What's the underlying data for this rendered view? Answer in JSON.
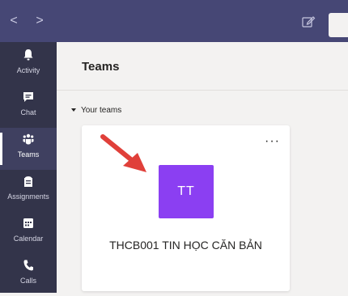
{
  "topbar": {
    "back_icon": "chevron-left-icon",
    "forward_icon": "chevron-right-icon",
    "compose_icon": "compose-icon",
    "back_glyph": "<",
    "forward_glyph": ">"
  },
  "rail": {
    "items": [
      {
        "label": "Activity",
        "icon": "bell-icon"
      },
      {
        "label": "Chat",
        "icon": "chat-icon"
      },
      {
        "label": "Teams",
        "icon": "teams-icon",
        "active": true
      },
      {
        "label": "Assignments",
        "icon": "assignments-icon"
      },
      {
        "label": "Calendar",
        "icon": "calendar-icon"
      },
      {
        "label": "Calls",
        "icon": "phone-icon"
      }
    ]
  },
  "main": {
    "title": "Teams",
    "section_label": "Your teams",
    "team_card": {
      "more_glyph": "···",
      "avatar_initials": "TT",
      "name": "THCB001 TIN HỌC CĂN BẢN"
    }
  },
  "colors": {
    "topbar": "#464775",
    "rail": "#33344a",
    "avatar": "#8b3ff2",
    "arrow": "#e0403a"
  }
}
